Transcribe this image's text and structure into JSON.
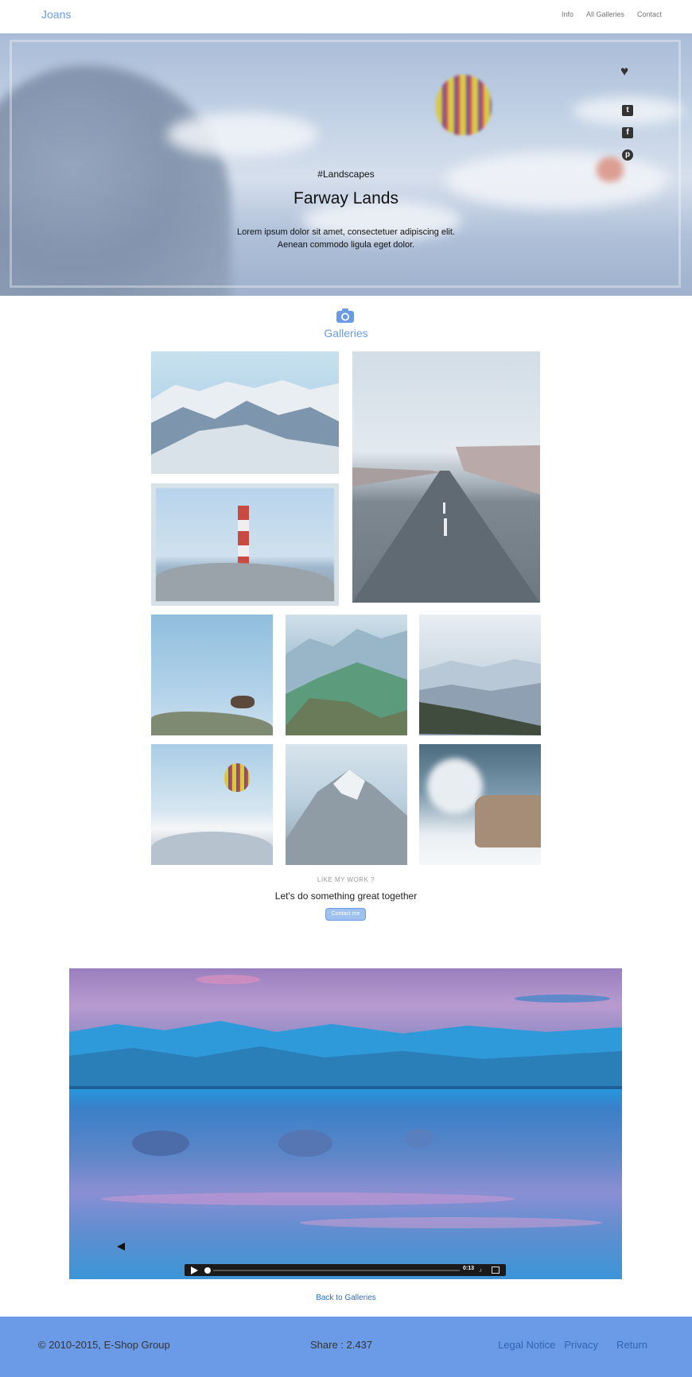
{
  "header": {
    "brand": "Joans",
    "nav": [
      "Info",
      "All Galleries",
      "Contact"
    ]
  },
  "hero": {
    "tag": "#Landscapes",
    "title": "Farway Lands",
    "desc_line1": "Lorem ipsum dolor sit amet, consectetuer adipiscing elit.",
    "desc_line2": "Aenean commodo ligula eget dolor.",
    "social": {
      "tumblr": "t",
      "facebook": "f",
      "pinterest": "p"
    }
  },
  "galleries": {
    "title": "Galleries"
  },
  "cta": {
    "small": "LIKE MY WORK ?",
    "big": "Let's do something great together",
    "button": "Contact me"
  },
  "video": {
    "time": "0:13"
  },
  "back_link": "Back to Galleries",
  "footer": {
    "copyright": "© 2010-2015, E-Shop Group",
    "share": "Share : 2.437",
    "links": [
      "Legal Notice",
      "Privacy",
      "Return"
    ]
  },
  "colors": {
    "accent": "#6b9be6",
    "footer_bg": "#6b9be6",
    "link": "#2f64b5"
  }
}
